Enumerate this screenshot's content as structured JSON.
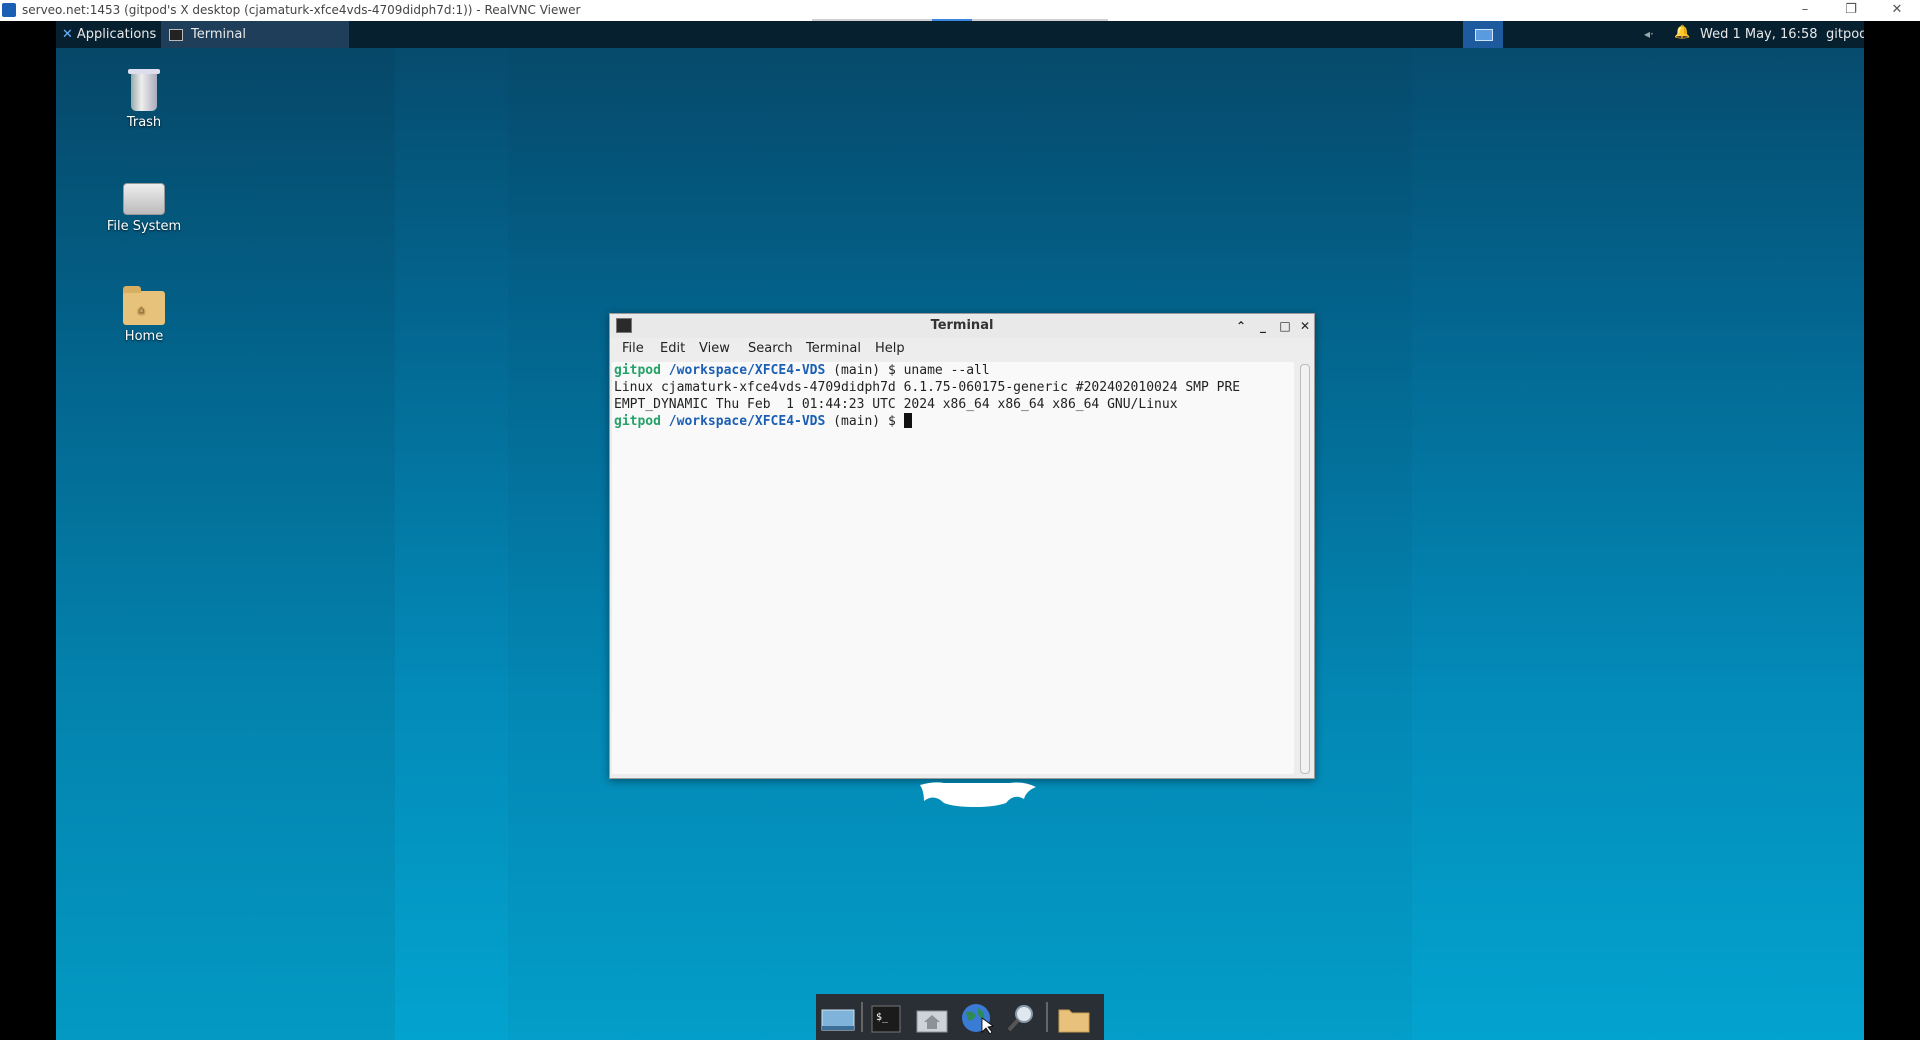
{
  "vnc": {
    "title": "serveo.net:1453 (gitpod's X desktop (cjamaturk-xfce4vds-4709didph7d:1)) - RealVNC Viewer",
    "minimize": "–",
    "restore": "❐",
    "close": "✕"
  },
  "panel": {
    "applications_label": "Applications",
    "task_label": "Terminal",
    "clock": "Wed  1 May, 16:58",
    "user": "gitpod"
  },
  "desktop_icons": [
    {
      "label": "Trash",
      "icon": "trash-icon"
    },
    {
      "label": "File System",
      "icon": "drive-icon"
    },
    {
      "label": "Home",
      "icon": "home-folder-icon"
    }
  ],
  "terminal": {
    "title": "Terminal",
    "menu": [
      "File",
      "Edit",
      "View",
      "Search",
      "Terminal",
      "Help"
    ],
    "lines": {
      "l1_user": "gitpod",
      "l1_path": "/workspace/XFCE4-VDS",
      "l1_rest": " (main) $ uname --all",
      "l2": "Linux cjamaturk-xfce4vds-4709didph7d 6.1.75-060175-generic #202402010024 SMP PRE",
      "l3": "EMPT_DYNAMIC Thu Feb  1 01:44:23 UTC 2024 x86_64 x86_64 x86_64 GNU/Linux",
      "l4_user": "gitpod",
      "l4_path": "/workspace/XFCE4-VDS",
      "l4_rest": " (main) $ "
    }
  },
  "dock_items": [
    "show-desktop-icon",
    "terminal-icon",
    "home-folder-icon",
    "web-browser-icon",
    "search-icon",
    "folder-icon"
  ],
  "colors": {
    "prompt_user": "#26a269",
    "prompt_path": "#1a5fb4",
    "panel_bg": "#07202f"
  }
}
